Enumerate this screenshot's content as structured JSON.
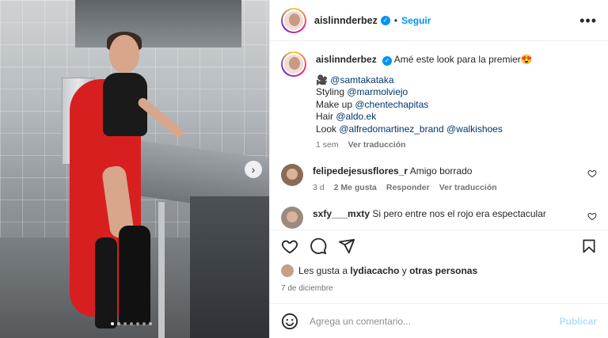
{
  "post": {
    "author": "aislinnderbez",
    "follow_label": "Seguir",
    "more_glyph": "•••",
    "verified_glyph": "✓",
    "separator": "•"
  },
  "caption": {
    "author": "aislinnderbez",
    "text": "Amé este look para la premier",
    "emoji": "😍",
    "lines": [
      {
        "prefix": "🎥 ",
        "handle": "@samtakataka"
      },
      {
        "prefix": "Styling ",
        "handle": "@marmolviejo"
      },
      {
        "prefix": "Make up ",
        "handle": "@chentechapitas"
      },
      {
        "prefix": "Hair ",
        "handle": "@aldo.ek"
      },
      {
        "prefix": "Look ",
        "handle": "@alfredomartinez_brand",
        "handle2": "@walkishoes"
      }
    ],
    "time": "1 sem",
    "translate": "Ver traducción"
  },
  "comments": [
    {
      "user": "felipedejesusflores_r",
      "text": "Amigo borrado",
      "time": "3 d",
      "likes": "2 Me gusta",
      "reply": "Responder",
      "translate": "Ver traducción"
    },
    {
      "user": "sxfy___mxty",
      "text": "Si pero entre nos el rojo era espectacular"
    }
  ],
  "likes_line": {
    "prefix": "Les gusta a",
    "user": "lydiacacho",
    "middle": "y",
    "rest": "otras personas"
  },
  "date": "7 de diciembre",
  "composer": {
    "placeholder": "Agrega un comentario...",
    "publish_label": "Publicar"
  },
  "carousel": {
    "next_glyph": "›",
    "slide_count": 7,
    "active_index": 0
  },
  "colors": {
    "accent": "#0095f6",
    "link": "#00376b",
    "muted": "#737373",
    "publish_disabled": "#b2dffc"
  }
}
